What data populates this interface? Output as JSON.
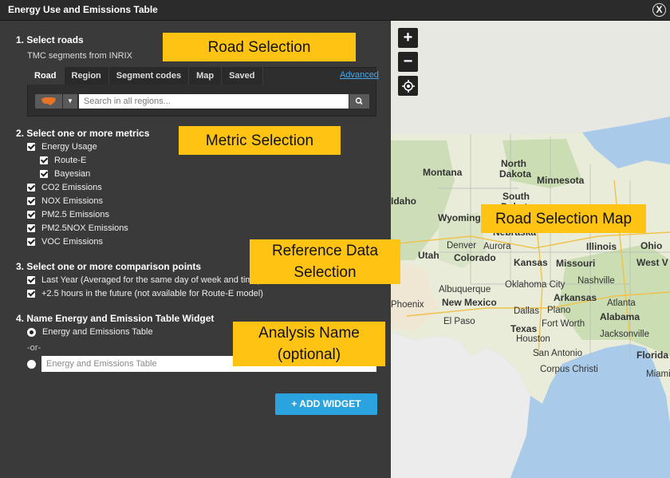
{
  "window": {
    "title": "Energy Use and Emissions Table",
    "close_label": "X"
  },
  "roads": {
    "heading": "1. Select roads",
    "subtitle": "TMC segments from INRIX",
    "tabs": [
      "Road",
      "Region",
      "Segment codes",
      "Map",
      "Saved"
    ],
    "advanced_label": "Advanced",
    "search_placeholder": "Search in all regions..."
  },
  "metrics": {
    "heading": "2. Select one or more metrics",
    "items": [
      "Energy Usage",
      "Route-E",
      "Bayesian",
      "CO2 Emissions",
      "NOX Emissions",
      "PM2.5 Emissions",
      "PM2.5NOX Emissions",
      "VOC Emissions"
    ]
  },
  "comparison": {
    "heading": "3. Select one or more comparison points",
    "items": [
      "Last Year (Averaged for the same day of week and time)",
      "+2.5 hours in the future (not available for Route-E model)"
    ]
  },
  "name": {
    "heading": "4. Name Energy and Emission Table Widget",
    "default_option": "Energy and Emissions Table",
    "or_label": "-or-",
    "input_placeholder": "Energy and Emissions Table"
  },
  "add_button_label": "+ ADD WIDGET",
  "map": {
    "zoom_in": "+",
    "zoom_out": "−",
    "states": [
      "Montana",
      "North",
      "Dakota",
      "Minnesota",
      "South",
      "Dakota",
      "Idaho",
      "Wyoming",
      "Nebraska",
      "Utah",
      "Colorado",
      "Kansas",
      "Missouri",
      "Illinois",
      "Ohio",
      "Oklahoma",
      "Arkansas",
      "New Mexico",
      "Texas",
      "Alabama",
      "Florida",
      "West V",
      "Miami"
    ],
    "cities": [
      "Denver",
      "Aurora",
      "Albuquerque",
      "Oklahoma City",
      "Nashville",
      "Phoenix",
      "Dallas",
      "Plano",
      "Atlanta",
      "El Paso",
      "Fort Worth",
      "Houston",
      "Jacksonville",
      "San Antonio",
      "Corpus Christi"
    ]
  },
  "annotations": {
    "road_selection": "Road Selection",
    "metric_selection": "Metric Selection",
    "road_map": "Road Selection Map",
    "reference_1": "Reference Data",
    "reference_2": "Selection",
    "analysis_1": "Analysis Name",
    "analysis_2": "(optional)"
  },
  "colors": {
    "accent_blue": "#2aa3df",
    "callout_yellow": "#ffc413",
    "panel": "#3a3a3a"
  }
}
